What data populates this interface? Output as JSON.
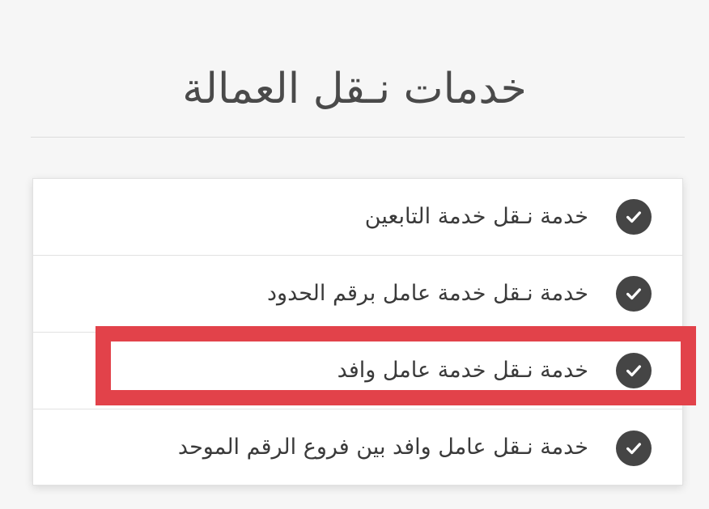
{
  "page": {
    "title": "خدمات نـقل العمالة"
  },
  "services": {
    "items": [
      {
        "label": "خدمة نـقل خدمة التابعين",
        "icon": "check-circle-icon",
        "highlighted": false
      },
      {
        "label": "خدمة نـقل خدمة عامل برقم الحدود",
        "icon": "check-circle-icon",
        "highlighted": false
      },
      {
        "label": "خدمة نـقل خدمة عامل وافد",
        "icon": "check-circle-icon",
        "highlighted": true
      },
      {
        "label": "خدمة نـقل عامل وافد بين فروع الرقم الموحد",
        "icon": "check-circle-icon",
        "highlighted": false
      }
    ]
  },
  "colors": {
    "background": "#f6f6f6",
    "title_text": "#4a4a4a",
    "check_circle": "#454545",
    "highlight_border": "#e2424a",
    "card_background": "#ffffff"
  }
}
